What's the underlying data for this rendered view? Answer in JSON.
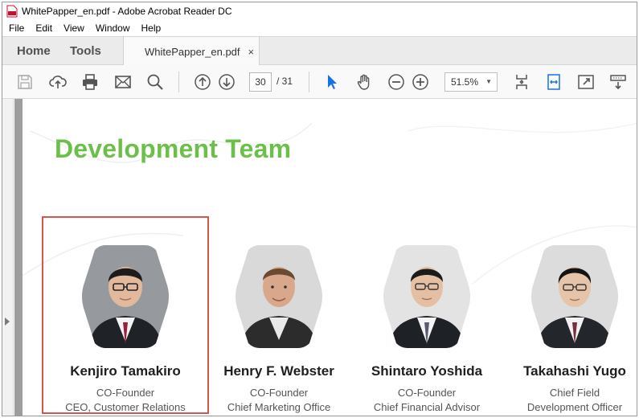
{
  "window": {
    "title": "WhitePapper_en.pdf - Adobe Acrobat Reader DC"
  },
  "menu": [
    "File",
    "Edit",
    "View",
    "Window",
    "Help"
  ],
  "tabs": {
    "home": "Home",
    "tools": "Tools",
    "document": "WhitePapper_en.pdf",
    "close": "×"
  },
  "toolbar": {
    "icons": [
      "save-icon",
      "upload-icon",
      "print-icon",
      "mail-icon",
      "search-icon",
      "page-up-icon",
      "page-down-icon",
      "select-cursor-icon",
      "hand-icon",
      "zoom-out-icon",
      "zoom-in-icon",
      "fit-page-icon",
      "fit-width-icon",
      "full-screen-icon",
      "read-mode-icon"
    ],
    "page_current": "30",
    "page_total": "/ 31",
    "zoom": "51.5%"
  },
  "document": {
    "heading": "Development Team",
    "heading_color": "#6cc04a",
    "highlight_color": "#d9534f",
    "members": [
      {
        "name": "Kenjiro Tamakiro",
        "role1": "CO-Founder",
        "role2": "CEO, Customer Relations"
      },
      {
        "name": "Henry F. Webster",
        "role1": "CO-Founder",
        "role2": "Chief Marketing Office"
      },
      {
        "name": "Shintaro Yoshida",
        "role1": "CO-Founder",
        "role2": "Chief Financial Advisor"
      },
      {
        "name": "Takahashi Yugo",
        "role1": "Chief Field",
        "role2": "Development Officer"
      }
    ]
  }
}
